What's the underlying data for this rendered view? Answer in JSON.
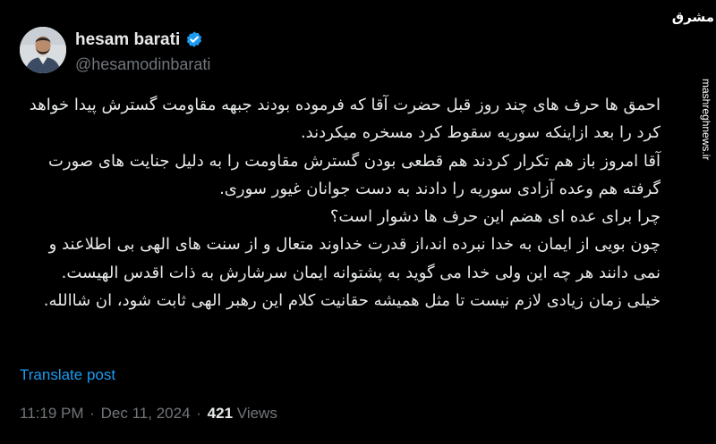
{
  "author": {
    "display_name": "hesam barati",
    "handle": "@hesamodinbarati",
    "verified": true,
    "verified_color": "#1d9bf0"
  },
  "post": {
    "lines": [
      "احمق ها حرف های چند روز قبل حضرت آقا که فرموده بودند جبهه مقاومت گسترش پیدا خواهد کرد را بعد ازاینکه سوریه سقوط کرد مسخره میکردند.",
      "آقا امروز باز هم  تکرار کردند هم قطعی بودن گسترش مقاومت را به دلیل جنایت های صورت گرفته هم وعده آزادی سوریه را دادند به دست جوانان غیور سوری.",
      "چرا برای عده ای هضم این حرف ها دشوار است؟",
      "چون بویی از ایمان به خدا نبرده اند،از قدرت خداوند متعال و از سنت های الهی بی اطلاعند و نمی دانند هر چه این ولی خدا می گوید به پشتوانه ایمان سرشارش به ذات اقدس الهیست.",
      "خیلی زمان زیادی لازم نیست تا مثل همیشه حقانیت کلام این رهبر الهی ثابت شود، ان شاالله."
    ],
    "translate_label": "Translate post",
    "time": "11:19 PM",
    "date": "Dec 11, 2024",
    "separator": "·",
    "views_count": "421",
    "views_label": "Views"
  },
  "watermark": {
    "logo_text": "مشرق",
    "site_text": "mashreghnews.ir"
  },
  "colors": {
    "background": "#000000",
    "text": "#e7e9ea",
    "muted": "#71767b",
    "link": "#1d9bf0"
  }
}
